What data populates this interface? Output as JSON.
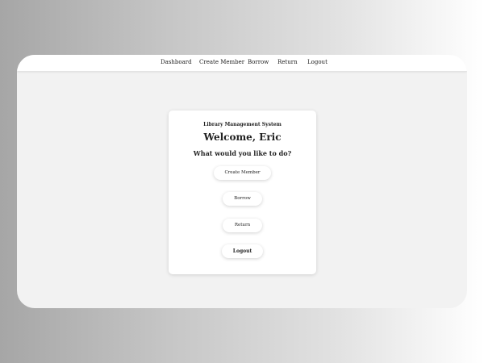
{
  "nav": {
    "dashboard": "Dashboard",
    "create_member": "Create Member",
    "borrow": "Borrow",
    "return": "Return",
    "logout": "Logout"
  },
  "card": {
    "system_title": "Library Management System",
    "welcome": "Welcome, Eric",
    "question": "What would you like to do?",
    "buttons": {
      "create_member": "Create Member",
      "borrow": "Borrow",
      "return": "Return",
      "logout": "Logout"
    }
  }
}
